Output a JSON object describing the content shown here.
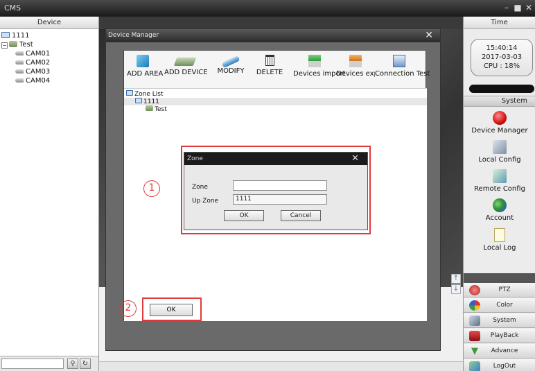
{
  "window": {
    "app_title": "CMS"
  },
  "left_panel": {
    "header": "Device",
    "tree": {
      "root": "1111",
      "device": "Test",
      "cameras": [
        "CAM01",
        "CAM02",
        "CAM03",
        "CAM04"
      ]
    }
  },
  "right_panel": {
    "header": "Time",
    "clock": {
      "time": "15:40:14",
      "date": "2017-03-03",
      "cpu": "CPU : 18%"
    },
    "system_header": "System",
    "menu": [
      {
        "label": "Device Manager",
        "icon": "device-manager-icon"
      },
      {
        "label": "Local Config",
        "icon": "local-config-icon"
      },
      {
        "label": "Remote Config",
        "icon": "remote-config-icon"
      },
      {
        "label": "Account",
        "icon": "account-icon"
      },
      {
        "label": "Local Log",
        "icon": "local-log-icon"
      }
    ],
    "buttons": [
      {
        "label": "PTZ",
        "icon": "ptz-icon"
      },
      {
        "label": "Color",
        "icon": "color-icon"
      },
      {
        "label": "System",
        "icon": "system-icon"
      },
      {
        "label": "PlayBack",
        "icon": "playback-icon"
      },
      {
        "label": "Advance",
        "icon": "advance-icon"
      },
      {
        "label": "LogOut",
        "icon": "logout-icon"
      }
    ]
  },
  "device_manager": {
    "title": "Device Manager",
    "toolbar": [
      {
        "label": "ADD AREA",
        "icon": "add-area-icon"
      },
      {
        "label": "ADD DEVICE",
        "icon": "add-device-icon"
      },
      {
        "label": "MODIFY",
        "icon": "modify-icon"
      },
      {
        "label": "DELETE",
        "icon": "delete-icon"
      },
      {
        "label": "Devices import",
        "icon": "import-icon"
      },
      {
        "label": "Devices expor",
        "icon": "export-icon"
      },
      {
        "label": "Connection  Test",
        "icon": "connection-test-icon"
      }
    ],
    "tree": {
      "root": "Zone List",
      "zone": "1111",
      "device": "Test"
    },
    "ok_label": "OK"
  },
  "zone_dialog": {
    "title": "Zone",
    "zone_label": "Zone",
    "zone_value": "",
    "upzone_label": "Up Zone",
    "upzone_value": "1111",
    "ok_label": "OK",
    "cancel_label": "Cancel"
  },
  "annotations": {
    "step1": "1",
    "step2": "2"
  },
  "colors": {
    "annotation_red": "#e03a3a",
    "titlebar_dark": "#1b1b1b"
  }
}
